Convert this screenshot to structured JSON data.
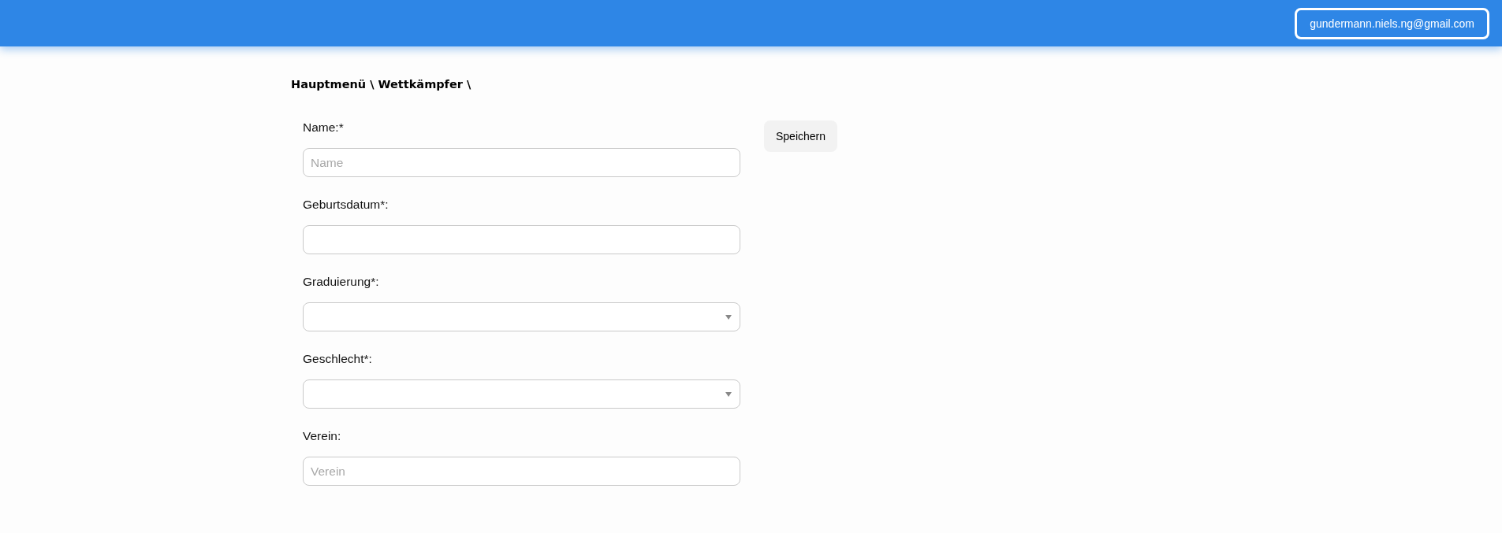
{
  "header": {
    "user_email": "gundermann.niels.ng@gmail.com"
  },
  "breadcrumb": "Hauptmenü \\ Wettkämpfer \\",
  "form": {
    "fields": [
      {
        "kind": "text",
        "label": "Name:*",
        "placeholder": "Name"
      },
      {
        "kind": "text",
        "label": "Geburtsdatum*:"
      },
      {
        "kind": "select",
        "label": "Graduierung*:"
      },
      {
        "kind": "select",
        "label": "Geschlecht*:"
      },
      {
        "kind": "text",
        "label": "Verein:",
        "placeholder": "Verein"
      }
    ]
  },
  "save_button": "Speichern"
}
